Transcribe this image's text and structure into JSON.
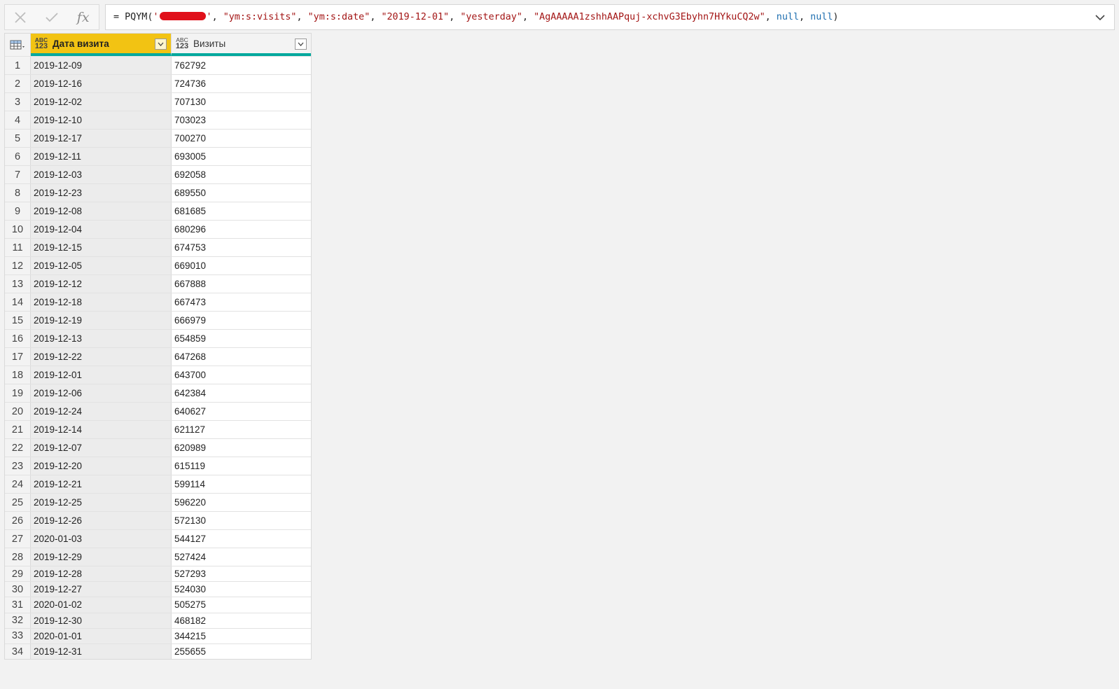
{
  "toolbar": {
    "cancel_icon": "x-icon",
    "confirm_icon": "check-icon",
    "fx_label": "fx"
  },
  "formula": {
    "prefix": "= PQYM(",
    "args_strings": [
      "'",
      "\"ym:s:visits\"",
      "\"ym:s:date\"",
      "\"2019-12-01\"",
      "\"yesterday\"",
      "\"AgAAAAA1zshhAAPquj-xchvG3Ebyhn7HYkuCQ2w\""
    ],
    "keywords": [
      "null",
      "null"
    ],
    "close": ")"
  },
  "table": {
    "columns": [
      {
        "type_top": "ABC",
        "type_bottom": "123",
        "label": "Дата визита"
      },
      {
        "type_top": "ABC",
        "type_bottom": "123",
        "label": "Визиты"
      }
    ],
    "rows": [
      {
        "n": "1",
        "date": "2019-12-09",
        "visits": "762792"
      },
      {
        "n": "2",
        "date": "2019-12-16",
        "visits": "724736"
      },
      {
        "n": "3",
        "date": "2019-12-02",
        "visits": "707130"
      },
      {
        "n": "4",
        "date": "2019-12-10",
        "visits": "703023"
      },
      {
        "n": "5",
        "date": "2019-12-17",
        "visits": "700270"
      },
      {
        "n": "6",
        "date": "2019-12-11",
        "visits": "693005"
      },
      {
        "n": "7",
        "date": "2019-12-03",
        "visits": "692058"
      },
      {
        "n": "8",
        "date": "2019-12-23",
        "visits": "689550"
      },
      {
        "n": "9",
        "date": "2019-12-08",
        "visits": "681685"
      },
      {
        "n": "10",
        "date": "2019-12-04",
        "visits": "680296"
      },
      {
        "n": "11",
        "date": "2019-12-15",
        "visits": "674753"
      },
      {
        "n": "12",
        "date": "2019-12-05",
        "visits": "669010"
      },
      {
        "n": "13",
        "date": "2019-12-12",
        "visits": "667888"
      },
      {
        "n": "14",
        "date": "2019-12-18",
        "visits": "667473"
      },
      {
        "n": "15",
        "date": "2019-12-19",
        "visits": "666979"
      },
      {
        "n": "16",
        "date": "2019-12-13",
        "visits": "654859"
      },
      {
        "n": "17",
        "date": "2019-12-22",
        "visits": "647268"
      },
      {
        "n": "18",
        "date": "2019-12-01",
        "visits": "643700"
      },
      {
        "n": "19",
        "date": "2019-12-06",
        "visits": "642384"
      },
      {
        "n": "20",
        "date": "2019-12-24",
        "visits": "640627"
      },
      {
        "n": "21",
        "date": "2019-12-14",
        "visits": "621127"
      },
      {
        "n": "22",
        "date": "2019-12-07",
        "visits": "620989"
      },
      {
        "n": "23",
        "date": "2019-12-20",
        "visits": "615119"
      },
      {
        "n": "24",
        "date": "2019-12-21",
        "visits": "599114"
      },
      {
        "n": "25",
        "date": "2019-12-25",
        "visits": "596220"
      },
      {
        "n": "26",
        "date": "2019-12-26",
        "visits": "572130"
      },
      {
        "n": "27",
        "date": "2020-01-03",
        "visits": "544127"
      },
      {
        "n": "28",
        "date": "2019-12-29",
        "visits": "527424"
      },
      {
        "n": "29",
        "date": "2019-12-28",
        "visits": "527293"
      },
      {
        "n": "30",
        "date": "2019-12-27",
        "visits": "524030"
      },
      {
        "n": "31",
        "date": "2020-01-02",
        "visits": "505275"
      },
      {
        "n": "32",
        "date": "2019-12-30",
        "visits": "468182"
      },
      {
        "n": "33",
        "date": "2020-01-01",
        "visits": "344215"
      },
      {
        "n": "34",
        "date": "2019-12-31",
        "visits": "255655"
      }
    ]
  },
  "colors": {
    "active_column_header": "#f2c313",
    "column_underline": "#00a89d",
    "string_token": "#a31515",
    "keyword_token": "#1f6fb0",
    "redaction": "#e0101a"
  }
}
